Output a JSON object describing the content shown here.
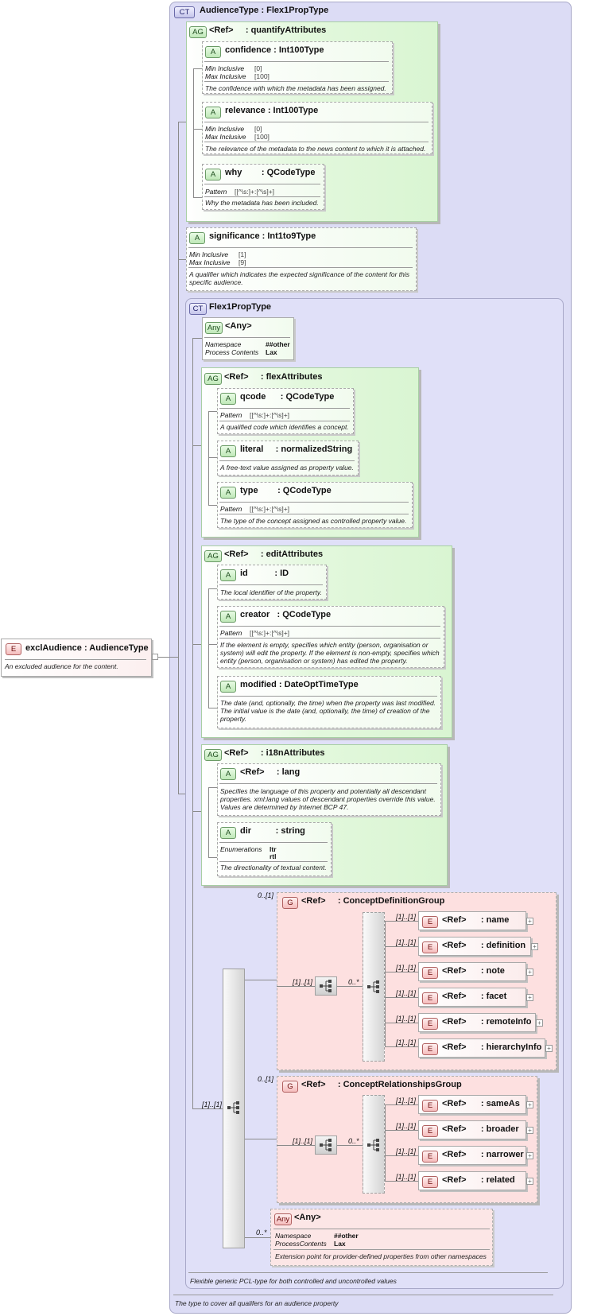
{
  "root": {
    "badge": "E",
    "name": "exclAudience",
    "type": ": AudienceType",
    "doc": "An excluded audience for the content."
  },
  "ct_outer": {
    "badge": "CT",
    "title": "AudienceType",
    "type": ": Flex1PropType",
    "doc": "The type to cover all qualifers for an audience property"
  },
  "quantify": {
    "badge": "AG",
    "ref": "<Ref>",
    "name": ": quantifyAttributes",
    "confidence": {
      "badge": "A",
      "name": "confidence",
      "type": ": Int100Type",
      "k1": "Min Inclusive",
      "v1": "[0]",
      "k2": "Max Inclusive",
      "v2": "[100]",
      "doc": "The confidence with which the metadata has been assigned."
    },
    "relevance": {
      "badge": "A",
      "name": "relevance",
      "type": ": Int100Type",
      "k1": "Min Inclusive",
      "v1": "[0]",
      "k2": "Max Inclusive",
      "v2": "[100]",
      "doc": "The relevance of the metadata to the news content to which it is attached."
    },
    "why": {
      "badge": "A",
      "name": "why",
      "type": ": QCodeType",
      "k1": "Pattern",
      "v1": "[[^\\s:]+:[^\\s]+]",
      "doc": "Why the metadata has been included."
    }
  },
  "significance": {
    "badge": "A",
    "name": "significance",
    "type": ": Int1to9Type",
    "k1": "Min Inclusive",
    "v1": "[1]",
    "k2": "Max Inclusive",
    "v2": "[9]",
    "doc_line1": "A qualifier which indicates the expected significance of the content for this",
    "doc_line2": "specific audience."
  },
  "flex1": {
    "badge": "CT",
    "title": "Flex1PropType",
    "doc": "Flexible generic PCL-type for both controlled and uncontrolled values"
  },
  "any1": {
    "badge": "Any",
    "name": "<Any>",
    "k1": "Namespace",
    "v1": "##other",
    "k2": "Process Contents",
    "v2": "Lax"
  },
  "flexattrs": {
    "badge": "AG",
    "ref": "<Ref>",
    "name": ": flexAttributes",
    "qcode": {
      "badge": "A",
      "name": "qcode",
      "type": ": QCodeType",
      "k1": "Pattern",
      "v1": "[[^\\s:]+:[^\\s]+]",
      "doc": "A qualified code which identifies a concept."
    },
    "literal": {
      "badge": "A",
      "name": "literal",
      "type": ": normalizedString",
      "doc": "A free-text value assigned as property value."
    },
    "type": {
      "badge": "A",
      "name": "type",
      "type": ": QCodeType",
      "k1": "Pattern",
      "v1": "[[^\\s:]+:[^\\s]+]",
      "doc": "The type of the concept assigned as controlled property value."
    }
  },
  "editattrs": {
    "badge": "AG",
    "ref": "<Ref>",
    "name": ": editAttributes",
    "id": {
      "badge": "A",
      "name": "id",
      "type": ": ID",
      "doc": "The local identifier of the property."
    },
    "creator": {
      "badge": "A",
      "name": "creator",
      "type": ": QCodeType",
      "k1": "Pattern",
      "v1": "[[^\\s:]+:[^\\s]+]",
      "doc_l1": "If the element is empty, specifies which entity (person, organisation or",
      "doc_l2": "system) will edit the property. If the element is non-empty, specifies which",
      "doc_l3": "entity (person, organisation or system) has edited the property."
    },
    "modified": {
      "badge": "A",
      "name": "modified",
      "type": ": DateOptTimeType",
      "doc_l1": "The date (and, optionally, the time) when the property was last modified.",
      "doc_l2": "The initial value is the date (and, optionally, the time) of creation of the",
      "doc_l3": "property."
    }
  },
  "i18n": {
    "badge": "AG",
    "ref": "<Ref>",
    "name": ": i18nAttributes",
    "lang": {
      "badge": "A",
      "ref": "<Ref>",
      "name": ": lang",
      "doc_l1": "Specifies the language of this property and potentially all descendant",
      "doc_l2": "properties. xml:lang values of descendant properties override this value.",
      "doc_l3": "Values are determined by Internet BCP 47."
    },
    "dir": {
      "badge": "A",
      "name": "dir",
      "type": ": string",
      "k1": "Enumerations",
      "v1": "ltr",
      "v2": "rtl",
      "doc": "The directionality of textual content."
    }
  },
  "seq_card": "[1]..[1]",
  "cdg": {
    "badge": "G",
    "ref": "<Ref>",
    "name": ": ConceptDefinitionGroup",
    "card_outer": "0..[1]",
    "card_seq": "[1]..[1]",
    "card_choice": "0..*",
    "items": [
      {
        "badge": "E",
        "ref": "<Ref>",
        "name": ": name",
        "card": "[1]..[1]"
      },
      {
        "badge": "E",
        "ref": "<Ref>",
        "name": ": definition",
        "card": "[1]..[1]"
      },
      {
        "badge": "E",
        "ref": "<Ref>",
        "name": ": note",
        "card": "[1]..[1]"
      },
      {
        "badge": "E",
        "ref": "<Ref>",
        "name": ": facet",
        "card": "[1]..[1]"
      },
      {
        "badge": "E",
        "ref": "<Ref>",
        "name": ": remoteInfo",
        "card": "[1]..[1]"
      },
      {
        "badge": "E",
        "ref": "<Ref>",
        "name": ": hierarchyInfo",
        "card": "[1]..[1]"
      }
    ]
  },
  "crg": {
    "badge": "G",
    "ref": "<Ref>",
    "name": ": ConceptRelationshipsGroup",
    "card_outer": "0..[1]",
    "card_seq": "[1]..[1]",
    "card_choice": "0..*",
    "items": [
      {
        "badge": "E",
        "ref": "<Ref>",
        "name": ": sameAs",
        "card": "[1]..[1]"
      },
      {
        "badge": "E",
        "ref": "<Ref>",
        "name": ": broader",
        "card": "[1]..[1]"
      },
      {
        "badge": "E",
        "ref": "<Ref>",
        "name": ": narrower",
        "card": "[1]..[1]"
      },
      {
        "badge": "E",
        "ref": "<Ref>",
        "name": ": related",
        "card": "[1]..[1]"
      }
    ]
  },
  "any2": {
    "badge": "Any",
    "name": "<Any>",
    "card": "0..*",
    "k1": "Namespace",
    "v1": "##other",
    "k2": "ProcessContents",
    "v2": "Lax",
    "doc": "Extension point for provider-defined properties from other namespaces"
  },
  "plus": "+"
}
